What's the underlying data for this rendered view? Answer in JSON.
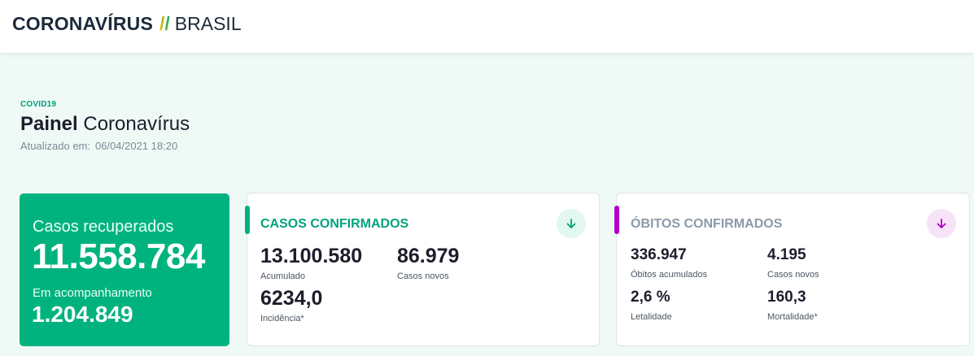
{
  "brand": {
    "main": "CORONAVÍRUS",
    "slash": "//",
    "country": "BRASIL"
  },
  "header": {
    "eyebrow": "COVID19",
    "title_bold": "Painel",
    "title_rest": "Coronavírus",
    "updated_label": "Atualizado em:",
    "updated_value": "06/04/2021 18:20"
  },
  "recovered": {
    "label": "Casos recuperados",
    "value": "11.558.784",
    "follow_label": "Em acompanhamento",
    "follow_value": "1.204.849"
  },
  "confirmed": {
    "title": "CASOS CONFIRMADOS",
    "accumulated_value": "13.100.580",
    "accumulated_label": "Acumulado",
    "new_value": "86.979",
    "new_label": "Casos novos",
    "incidence_value": "6234,0",
    "incidence_label": "Incidência*",
    "icon": "arrow-down-icon"
  },
  "deaths": {
    "title": "ÓBITOS CONFIRMADOS",
    "accumulated_value": "336.947",
    "accumulated_label": "Óbitos acumulados",
    "new_value": "4.195",
    "new_label": "Casos novos",
    "lethality_value": "2,6 %",
    "lethality_label": "Letalidade",
    "mortality_value": "160,3",
    "mortality_label": "Mortalidade*",
    "icon": "arrow-down-icon"
  },
  "colors": {
    "green": "#00b37e",
    "teal_title": "#00a37a",
    "purple": "#b300c8",
    "gray_title": "#8c9aa8",
    "page_bg": "#effaf7"
  }
}
